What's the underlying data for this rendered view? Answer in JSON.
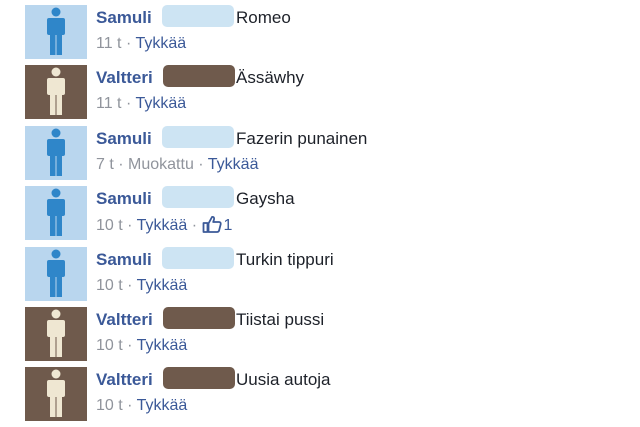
{
  "comments": [
    {
      "author": "Samuli",
      "text": "Romeo",
      "time": "11 t",
      "edited_label": "",
      "like_label": "Tykkää",
      "likes": "",
      "avatar_color": "#b9d6ee",
      "figure_color": "#2f86c9",
      "redaction_color": "#cde4f3"
    },
    {
      "author": "Valtteri",
      "text": "Ässäwhy",
      "time": "11 t",
      "edited_label": "",
      "like_label": "Tykkää",
      "likes": "",
      "avatar_color": "#6f5a4c",
      "figure_color": "#efe7d2",
      "redaction_color": "#6f5a4c"
    },
    {
      "author": "Samuli",
      "text": "Fazerin punainen",
      "time": "7 t",
      "edited_label": "Muokattu",
      "like_label": "Tykkää",
      "likes": "",
      "avatar_color": "#b9d6ee",
      "figure_color": "#2f86c9",
      "redaction_color": "#cde4f3"
    },
    {
      "author": "Samuli",
      "text": "Gaysha",
      "time": "10 t",
      "edited_label": "",
      "like_label": "Tykkää",
      "likes": "1",
      "avatar_color": "#b9d6ee",
      "figure_color": "#2f86c9",
      "redaction_color": "#cde4f3"
    },
    {
      "author": "Samuli",
      "text": "Turkin tippuri",
      "time": "10 t",
      "edited_label": "",
      "like_label": "Tykkää",
      "likes": "",
      "avatar_color": "#b9d6ee",
      "figure_color": "#2f86c9",
      "redaction_color": "#cde4f3"
    },
    {
      "author": "Valtteri",
      "text": "Tiistai pussi",
      "time": "10 t",
      "edited_label": "",
      "like_label": "Tykkää",
      "likes": "",
      "avatar_color": "#6f5a4c",
      "figure_color": "#efe7d2",
      "redaction_color": "#6f5a4c"
    },
    {
      "author": "Valtteri",
      "text": "Uusia autoja",
      "time": "10 t",
      "edited_label": "",
      "like_label": "Tykkää",
      "likes": "",
      "avatar_color": "#6f5a4c",
      "figure_color": "#efe7d2",
      "redaction_color": "#6f5a4c"
    }
  ],
  "separator": "·",
  "icons": {
    "avatar": "person-silhouette-icon",
    "like": "thumbs-up-icon"
  },
  "colors": {
    "name": "#3b5998",
    "text": "#1d2129",
    "meta": "#90949c",
    "link": "#3b5998"
  }
}
